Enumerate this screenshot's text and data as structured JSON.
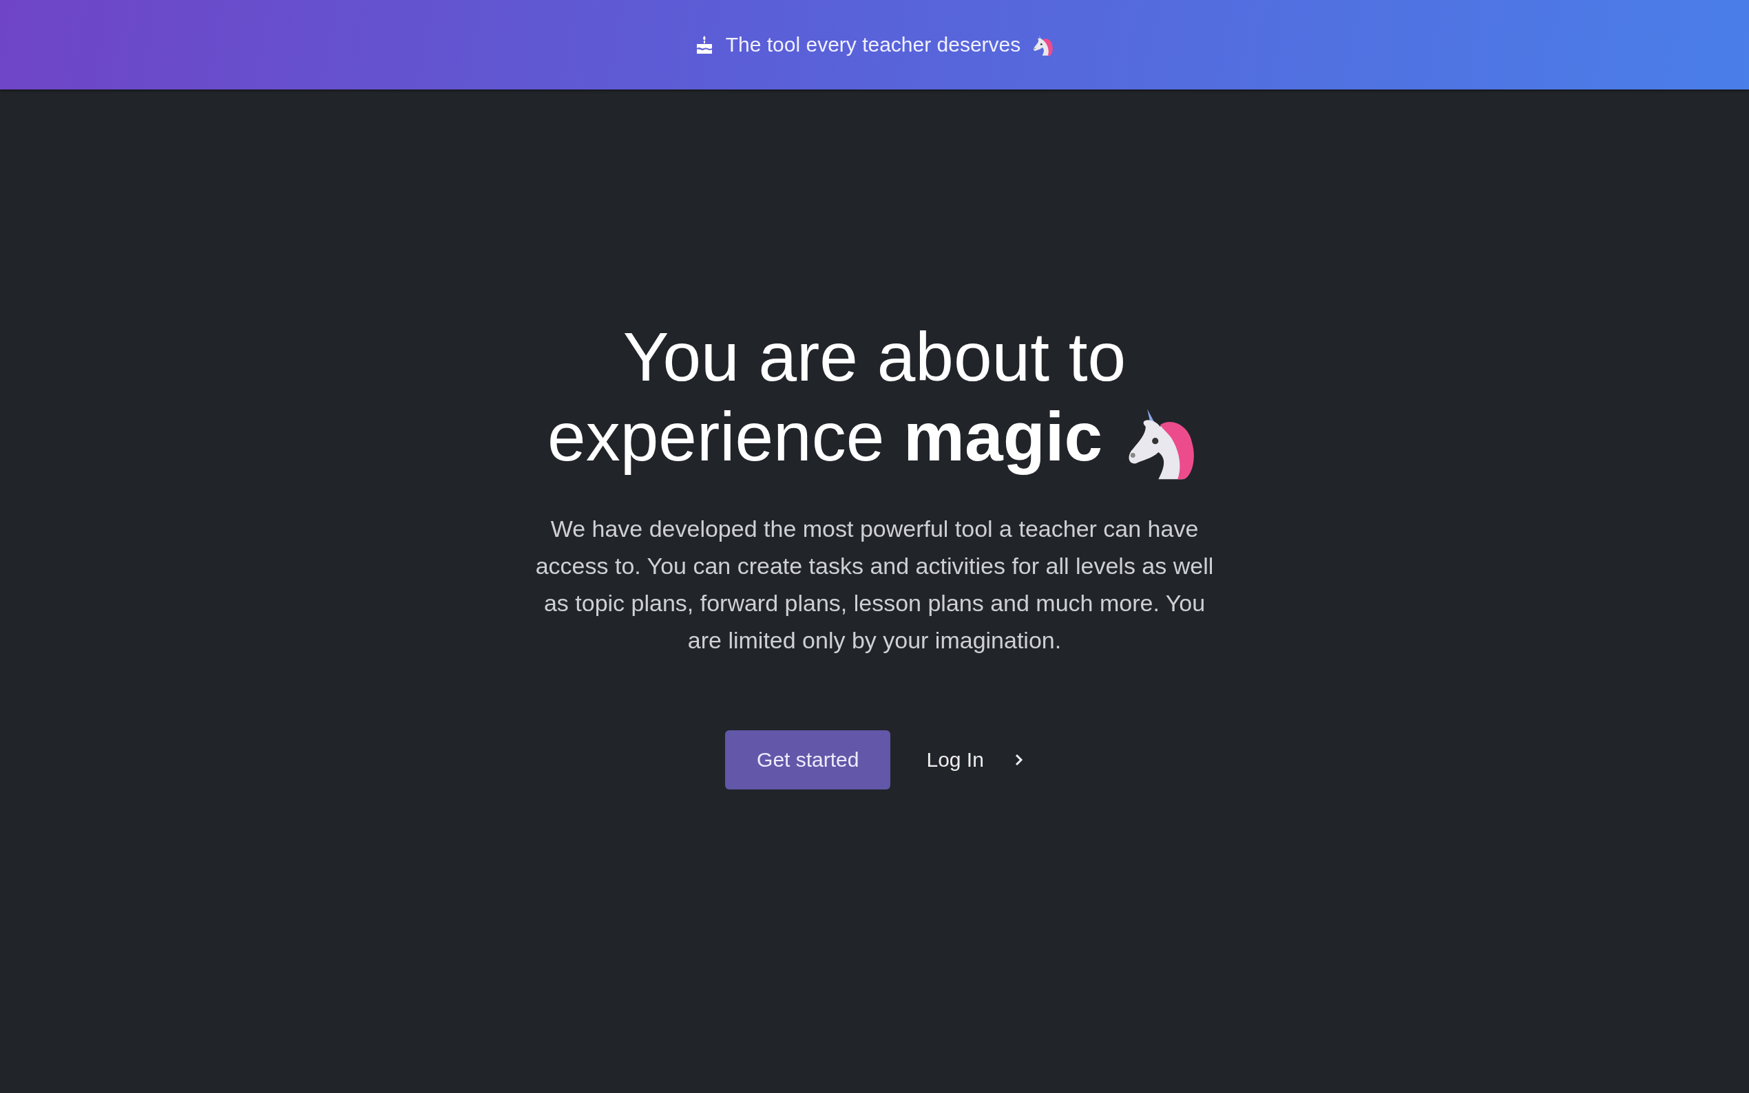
{
  "banner": {
    "text": "The tool every teacher deserves"
  },
  "hero": {
    "title": "You are about to experience **magic**",
    "description": "We have developed the most powerful tool a teacher can have access to. You can create tasks and activities for all levels as well as topic plans, forward plans, lesson plans and much more. You are limited only by your imagination."
  },
  "actions": [
    {
      "label": "Get started",
      "kind": "primary"
    },
    {
      "label": "Log In",
      "kind": "link"
    }
  ]
}
